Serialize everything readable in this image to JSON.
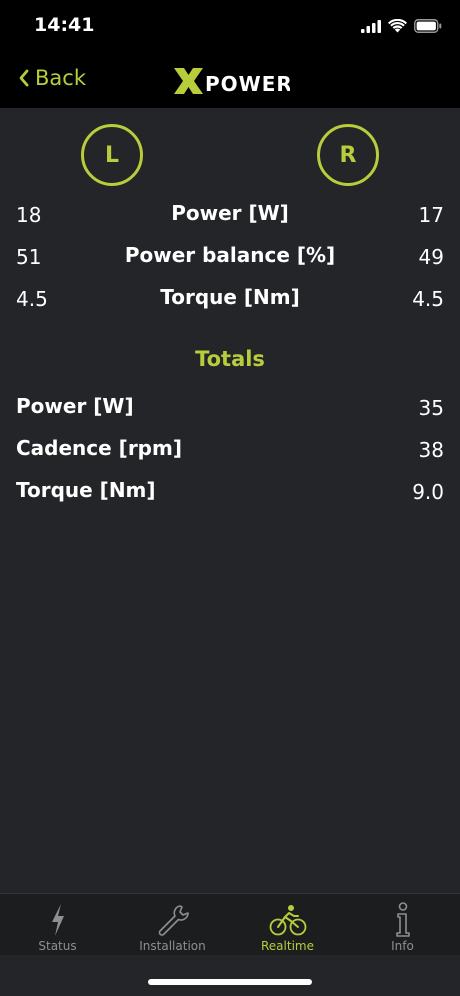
{
  "status_bar": {
    "time": "14:41"
  },
  "nav": {
    "back_label": "Back",
    "logo_text": "POWER",
    "logo_mark": "X"
  },
  "sides": {
    "left": "L",
    "right": "R"
  },
  "per_side": [
    {
      "label": "Power [W]",
      "left": "18",
      "right": "17"
    },
    {
      "label": "Power balance [%]",
      "left": "51",
      "right": "49"
    },
    {
      "label": "Torque [Nm]",
      "left": "4.5",
      "right": "4.5"
    }
  ],
  "totals": {
    "title": "Totals",
    "rows": [
      {
        "label": "Power [W]",
        "value": "35"
      },
      {
        "label": "Cadence [rpm]",
        "value": "38"
      },
      {
        "label": "Torque [Nm]",
        "value": "9.0"
      }
    ]
  },
  "tabs": [
    {
      "label": "Status",
      "icon": "lightning-icon",
      "active": false
    },
    {
      "label": "Installation",
      "icon": "wrench-icon",
      "active": false
    },
    {
      "label": "Realtime",
      "icon": "cyclist-icon",
      "active": true
    },
    {
      "label": "Info",
      "icon": "info-icon",
      "active": false
    }
  ],
  "colors": {
    "accent": "#b8cc3c",
    "background": "#232528",
    "bar": "#000000",
    "tab_inactive": "#8e8f93"
  }
}
